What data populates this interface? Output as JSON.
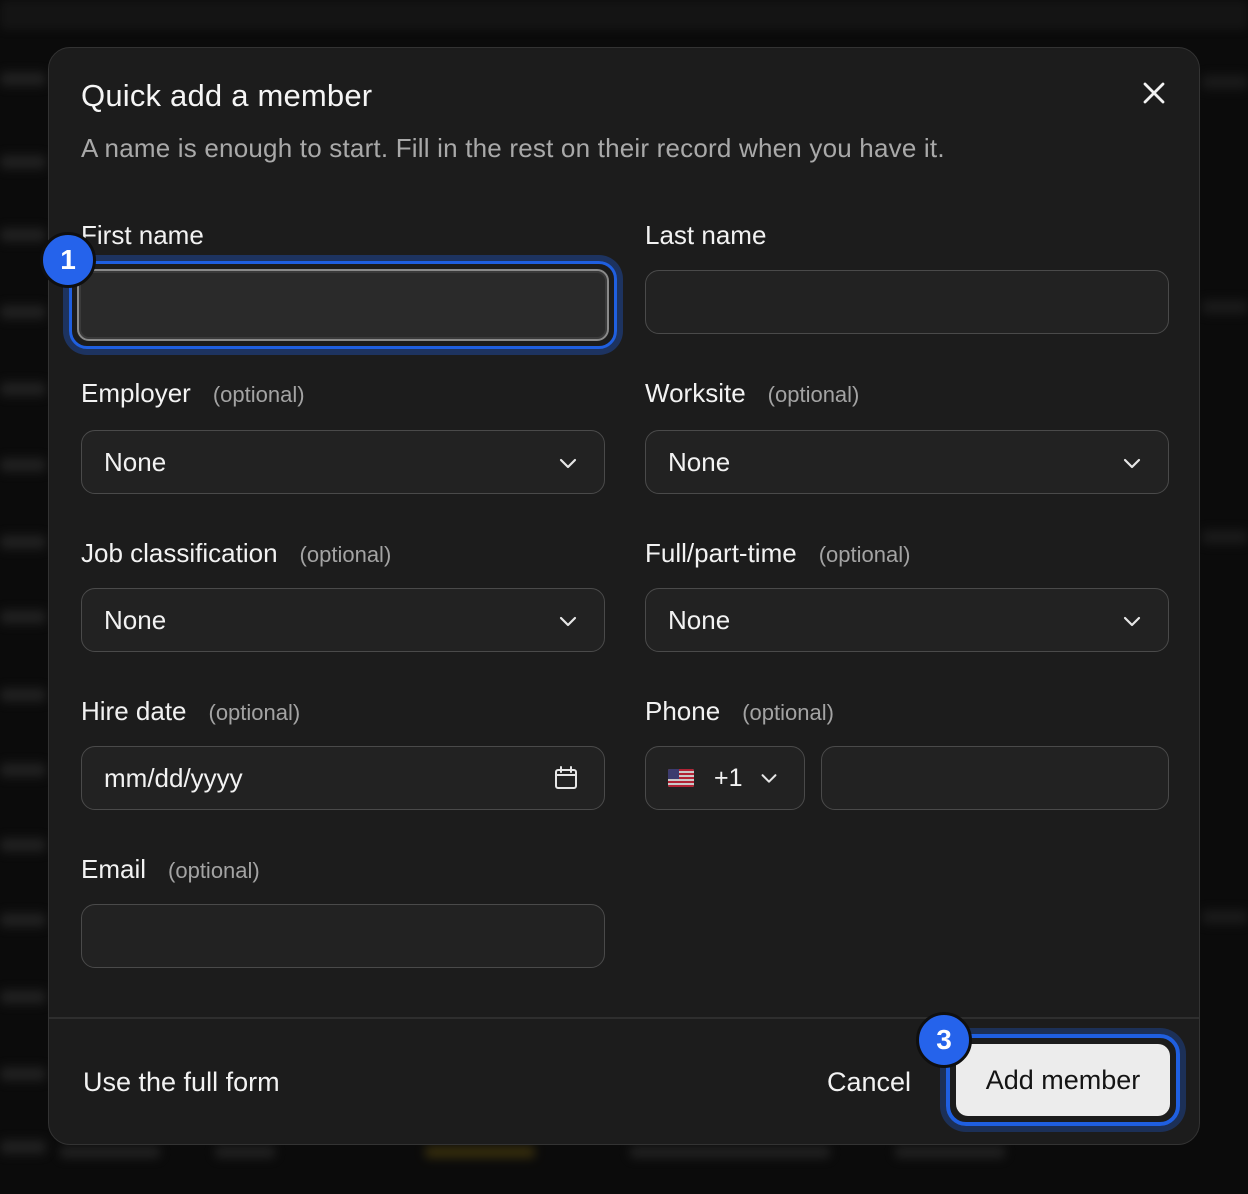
{
  "dialog": {
    "title": "Quick add a member",
    "subtitle": "A name is enough to start. Fill in the rest on their record when you have it.",
    "close_icon": "close-icon"
  },
  "fields": {
    "first_name": {
      "label": "First name",
      "value": ""
    },
    "last_name": {
      "label": "Last name",
      "value": ""
    },
    "employer": {
      "label": "Employer",
      "optional": "(optional)",
      "value": "None"
    },
    "worksite": {
      "label": "Worksite",
      "optional": "(optional)",
      "value": "None"
    },
    "job_classification": {
      "label": "Job classification",
      "optional": "(optional)",
      "value": "None"
    },
    "employment_type": {
      "label": "Full/part-time",
      "optional": "(optional)",
      "value": "None"
    },
    "hire_date": {
      "label": "Hire date",
      "optional": "(optional)",
      "placeholder": "mm/dd/yyyy"
    },
    "phone": {
      "label": "Phone",
      "optional": "(optional)",
      "country_code": "+1",
      "flag": "us-flag-icon",
      "value": ""
    },
    "email": {
      "label": "Email",
      "optional": "(optional)",
      "value": ""
    }
  },
  "footer": {
    "full_form_link": "Use the full form",
    "cancel_label": "Cancel",
    "submit_label": "Add member"
  },
  "badges": {
    "first": "1",
    "third": "3"
  },
  "colors": {
    "accent": "#2563eb",
    "dialog_bg": "#1c1c1c",
    "submit_bg": "#ececec"
  }
}
